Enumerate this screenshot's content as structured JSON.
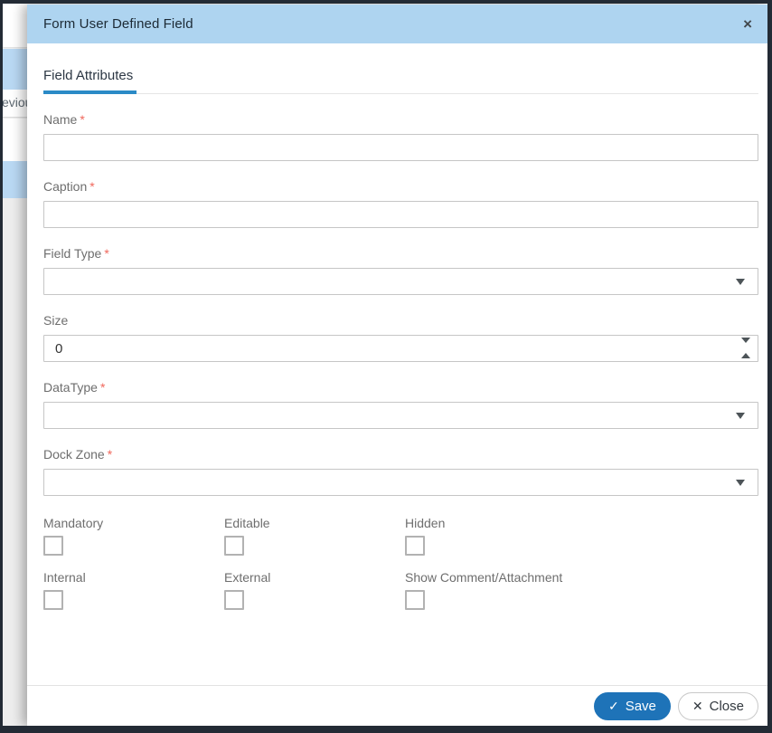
{
  "window": {
    "title": "Form User Defined Field",
    "close_icon": "×"
  },
  "background": {
    "fragment_text": "eviou"
  },
  "ui": {
    "required_marker": "*"
  },
  "tabs": [
    {
      "label": "Field Attributes",
      "active": true
    }
  ],
  "form": {
    "fields": [
      {
        "label": "Name",
        "required": true,
        "type": "text",
        "value": ""
      },
      {
        "label": "Caption",
        "required": true,
        "type": "text",
        "value": ""
      },
      {
        "label": "Field Type",
        "required": true,
        "type": "select",
        "value": ""
      },
      {
        "label": "Size",
        "required": false,
        "type": "number",
        "value": "0"
      },
      {
        "label": "DataType",
        "required": true,
        "type": "select",
        "value": ""
      },
      {
        "label": "Dock Zone",
        "required": true,
        "type": "select",
        "value": ""
      }
    ],
    "checkboxes": [
      {
        "label": "Mandatory",
        "checked": false
      },
      {
        "label": "Editable",
        "checked": false
      },
      {
        "label": "Hidden",
        "checked": false
      },
      {
        "label": "Internal",
        "checked": false
      },
      {
        "label": "External",
        "checked": false
      },
      {
        "label": "Show Comment/Attachment",
        "checked": false
      }
    ]
  },
  "footer": {
    "save_label": "Save",
    "save_icon": "✓",
    "close_label": "Close",
    "close_icon": "✕"
  },
  "colors": {
    "header_bg": "#aed4f0",
    "accent_blue": "#2b8ac6",
    "save_bg": "#1e73b8",
    "required": "#f0685c",
    "row_highlight": "#b9d8f3"
  }
}
